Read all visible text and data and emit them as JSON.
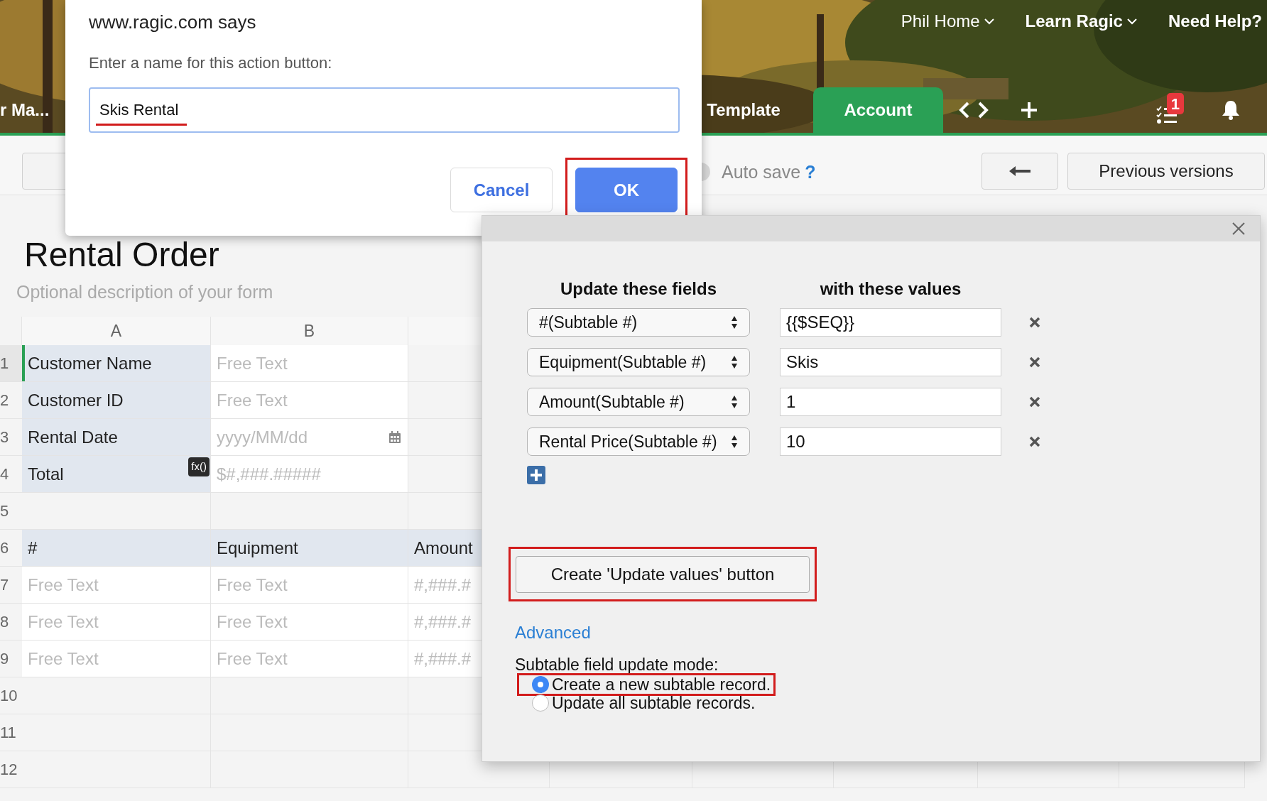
{
  "header": {
    "nav_links": [
      {
        "label": "Phil Home",
        "bold": false,
        "has_caret": true
      },
      {
        "label": "Learn Ragic",
        "bold": true,
        "has_caret": true
      },
      {
        "label": "Need Help?",
        "bold": true,
        "has_caret": false
      }
    ],
    "tabs": [
      {
        "label": "r Ma...",
        "selected": false
      },
      {
        "label": "Template",
        "selected": false
      },
      {
        "label": "Account",
        "selected": true
      }
    ],
    "task_badge": "1"
  },
  "toolbar": {
    "auto_save": {
      "label": "Auto save",
      "help": "?",
      "on": false
    },
    "previous_versions": "Previous versions"
  },
  "form": {
    "title": "Rental Order",
    "description_placeholder": "Optional description of your form",
    "columns": [
      "A",
      "B"
    ],
    "rows": [
      {
        "number": "1",
        "selected": true,
        "cells": [
          {
            "kind": "label",
            "text": "Customer Name"
          },
          {
            "kind": "input",
            "text": "Free Text"
          }
        ]
      },
      {
        "number": "2",
        "selected": false,
        "cells": [
          {
            "kind": "label",
            "text": "Customer ID"
          },
          {
            "kind": "input",
            "text": "Free Text"
          }
        ]
      },
      {
        "number": "3",
        "selected": false,
        "cells": [
          {
            "kind": "label",
            "text": "Rental Date"
          },
          {
            "kind": "date",
            "text": "yyyy/MM/dd"
          }
        ]
      },
      {
        "number": "4",
        "selected": false,
        "cells": [
          {
            "kind": "label",
            "text": "Total",
            "badge": "fx()"
          },
          {
            "kind": "input",
            "text": "$#,###.#####"
          }
        ]
      },
      {
        "number": "5",
        "selected": false,
        "cells": []
      },
      {
        "number": "6",
        "selected": false,
        "cells": [
          {
            "kind": "label",
            "text": "#"
          },
          {
            "kind": "label",
            "text": "Equipment"
          },
          {
            "kind": "label",
            "text": "Amount"
          }
        ]
      },
      {
        "number": "7",
        "selected": false,
        "cells": [
          {
            "kind": "input",
            "text": "Free Text"
          },
          {
            "kind": "input",
            "text": "Free Text"
          },
          {
            "kind": "input",
            "text": "#,###.#"
          }
        ]
      },
      {
        "number": "8",
        "selected": false,
        "cells": [
          {
            "kind": "input",
            "text": "Free Text"
          },
          {
            "kind": "input",
            "text": "Free Text"
          },
          {
            "kind": "input",
            "text": "#,###.#"
          }
        ]
      },
      {
        "number": "9",
        "selected": false,
        "cells": [
          {
            "kind": "input",
            "text": "Free Text"
          },
          {
            "kind": "input",
            "text": "Free Text"
          },
          {
            "kind": "input",
            "text": "#,###.#"
          }
        ]
      },
      {
        "number": "10",
        "selected": false,
        "cells": []
      },
      {
        "number": "11",
        "selected": false,
        "cells": []
      },
      {
        "number": "12",
        "selected": false,
        "cells": []
      }
    ]
  },
  "dialog": {
    "title": "www.ragic.com says",
    "prompt": "Enter a name for this action button:",
    "value": "Skis Rental",
    "value_underlined": true,
    "buttons": [
      {
        "label": "Cancel",
        "kind": "secondary",
        "highlighted": false
      },
      {
        "label": "OK",
        "kind": "primary",
        "highlighted": true
      }
    ]
  },
  "panel": {
    "headings": [
      "Update these fields",
      "with these values"
    ],
    "mappings": [
      {
        "field": "#(Subtable #)",
        "value": "{{$SEQ}}"
      },
      {
        "field": "Equipment(Subtable #)",
        "value": "Skis"
      },
      {
        "field": "Amount(Subtable #)",
        "value": "1"
      },
      {
        "field": "Rental Price(Subtable #)",
        "value": "10"
      }
    ],
    "create_button": {
      "label": "Create 'Update values' button",
      "highlighted": true
    },
    "advanced_link": "Advanced",
    "mode_label": "Subtable field update mode:",
    "modes": [
      {
        "label": "Create a new subtable record.",
        "selected": true,
        "highlighted": true
      },
      {
        "label": "Update all subtable records.",
        "selected": false,
        "highlighted": false
      }
    ]
  }
}
